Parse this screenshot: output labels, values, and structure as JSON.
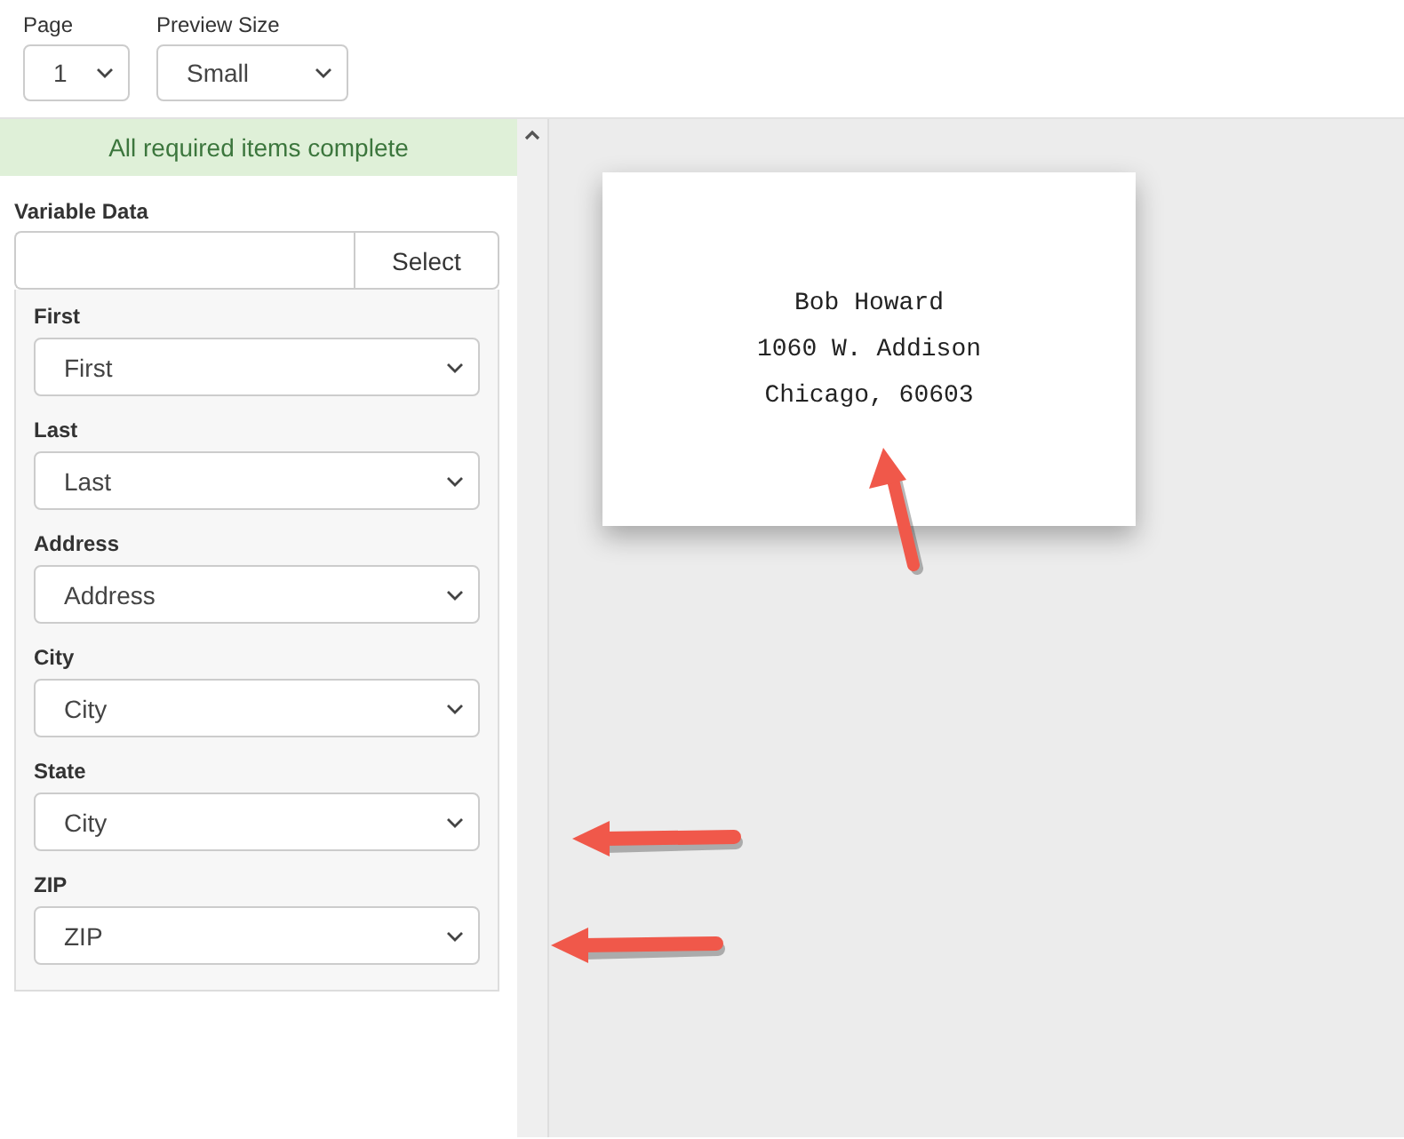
{
  "toolbar": {
    "page": {
      "label": "Page",
      "value": "1"
    },
    "preview_size": {
      "label": "Preview Size",
      "value": "Small"
    }
  },
  "status_banner": "All required items complete",
  "variable_data": {
    "label": "Variable Data",
    "button": "Select",
    "fields": [
      {
        "label": "First",
        "value": "First"
      },
      {
        "label": "Last",
        "value": "Last"
      },
      {
        "label": "Address",
        "value": "Address"
      },
      {
        "label": "City",
        "value": "City"
      },
      {
        "label": "State",
        "value": "City"
      },
      {
        "label": "ZIP",
        "value": "ZIP"
      }
    ]
  },
  "preview_card": {
    "lines": [
      "Bob Howard",
      "1060 W. Addison",
      "Chicago, 60603"
    ]
  }
}
